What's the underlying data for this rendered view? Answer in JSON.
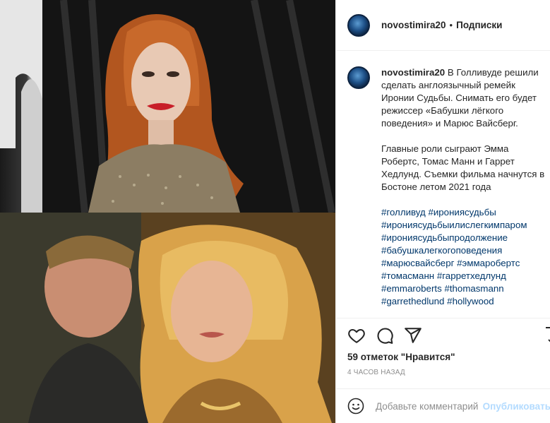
{
  "header": {
    "username": "novostimira20",
    "separator": "•",
    "follow_label": "Подписки"
  },
  "caption": {
    "username": "novostimira20",
    "text1": "В Голливуде решили сделать англоязычный ремейк Иронии Судьбы. Снимать его будет режиссер «Бабушки лёгкого поведения» и Марюс Вайсберг.",
    "text2": "Главные роли сыграют Эмма Робертс, Томас Манн и Гаррет Хедлунд. Съемки фильма начнутся в Бостоне летом 2021 года",
    "hashtags": [
      "#голливуд",
      "#ирониясудьбы",
      "#ирониясудьбыилислегкимпаром",
      "#ирониясудьбыпродолжение",
      "#бабушкалегкогоповедения",
      "#марюсвайсберг",
      "#эммаробертс",
      "#томасманн",
      "#гарретхедлунд",
      "#emmaroberts",
      "#thomasmann",
      "#garrethedlund",
      "#hollywood"
    ]
  },
  "actions": {
    "like_icon": "heart-icon",
    "comment_icon": "comment-icon",
    "share_icon": "paper-plane-icon",
    "save_icon": "bookmark-icon"
  },
  "likes": "59 отметок \"Нравится\"",
  "time": "4 ЧАСОВ НАЗАД",
  "comment": {
    "placeholder": "Добавьте комментарий...",
    "post_label": "Опубликовать"
  },
  "colors": {
    "hashtag": "#00376b",
    "post_button_disabled": "#b3dbff",
    "muted": "#8e8e8e",
    "border": "#efefef"
  }
}
